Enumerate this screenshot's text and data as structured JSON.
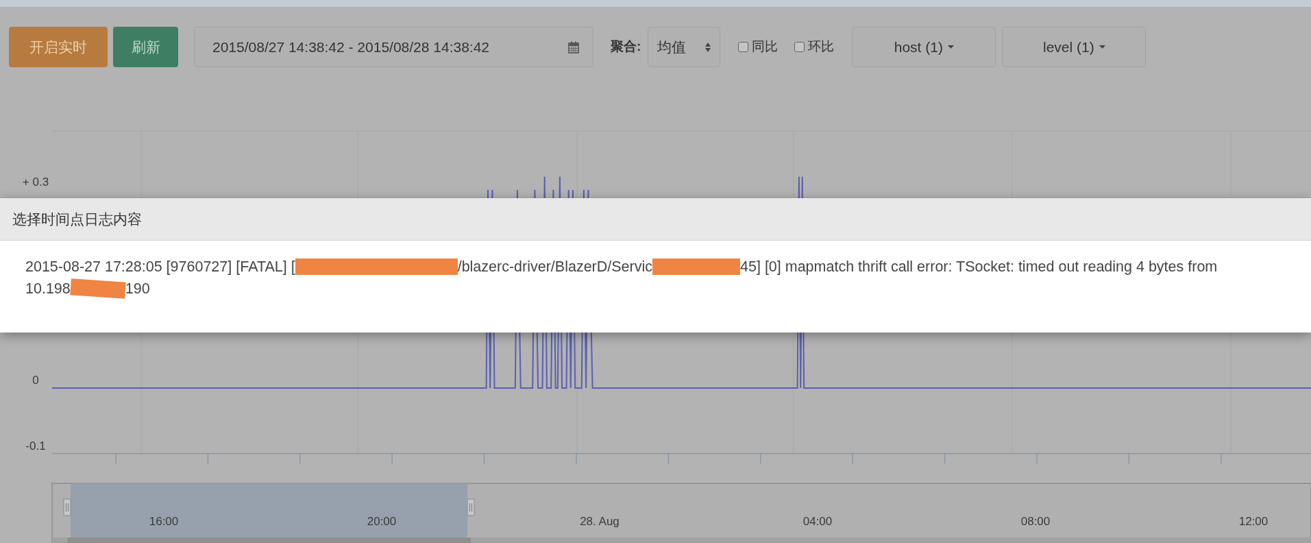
{
  "toolbar": {
    "buttons": [
      {
        "label": "开启实时",
        "kind": "realtime"
      },
      {
        "label": "刷新",
        "kind": "refresh"
      }
    ],
    "date_range": "2015/08/27 14:38:42 - 2015/08/28 14:38:42",
    "aggregate": {
      "label": "聚合:",
      "value": "均值"
    },
    "checkboxes": [
      {
        "label": "同比",
        "checked": false
      },
      {
        "label": "环比",
        "checked": false
      }
    ],
    "dropdowns": [
      "host (1)",
      "level (1)"
    ]
  },
  "chart": {
    "y_labels": [
      "+ 0.3",
      "0",
      "-0.1"
    ]
  },
  "navigator": {
    "labels": [
      "16:00",
      "20:00",
      "28. Aug",
      "04:00",
      "08:00",
      "12:00"
    ]
  },
  "modal": {
    "title": "选择时间点日志内容",
    "lines": [
      [
        {
          "kind": "text",
          "text": "2015-08-27 17:28:05 [9760727] [FATAL] ["
        },
        {
          "kind": "redaction"
        },
        {
          "kind": "text",
          "text": "/blazerc-driver/BlazerD/Servic"
        },
        {
          "kind": "redaction"
        },
        {
          "kind": "text",
          "text": "45] [0] mapmatch thrift call error: TSocket: timed out reading 4 bytes from"
        }
      ],
      [
        {
          "kind": "text",
          "text": "10.198"
        },
        {
          "kind": "redaction"
        },
        {
          "kind": "text",
          "text": "190"
        }
      ]
    ]
  }
}
